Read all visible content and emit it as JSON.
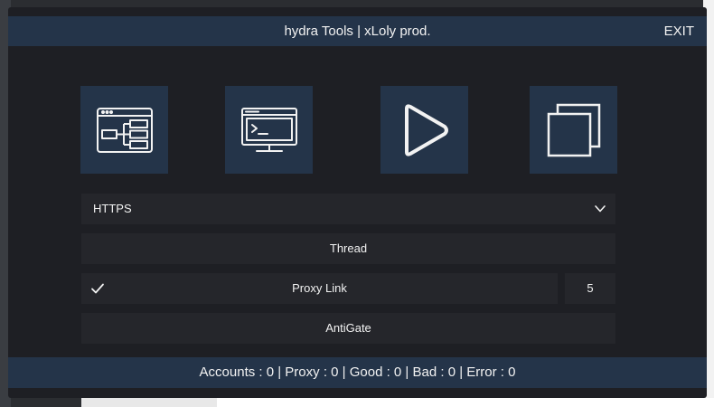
{
  "window": {
    "title": "hydra Tools | xLoly prod.",
    "exit_label": "EXIT"
  },
  "tiles": [
    {
      "icon": "flowchart-icon"
    },
    {
      "icon": "terminal-icon"
    },
    {
      "icon": "play-icon"
    },
    {
      "icon": "copy-icon"
    }
  ],
  "proxy_type": {
    "selected": "HTTPS"
  },
  "thread_button": "Thread",
  "proxy_link": {
    "label": "Proxy Link",
    "checked": true
  },
  "thread_count": "5",
  "antigate_button": "AntiGate",
  "status": "Accounts : 0 | Proxy : 0 | Good : 0 | Bad : 0 | Error : 0",
  "colors": {
    "accent": "#243449",
    "panel": "#1e1f24",
    "field": "#25262b",
    "text": "#f2f2f2"
  }
}
